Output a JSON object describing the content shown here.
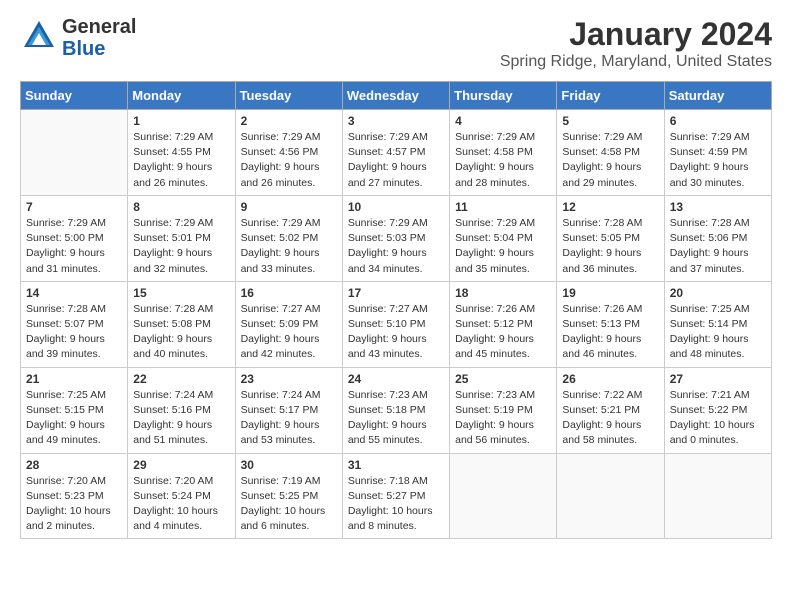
{
  "logo": {
    "name_general": "General",
    "name_blue": "Blue"
  },
  "header": {
    "month_year": "January 2024",
    "location": "Spring Ridge, Maryland, United States"
  },
  "weekdays": [
    "Sunday",
    "Monday",
    "Tuesday",
    "Wednesday",
    "Thursday",
    "Friday",
    "Saturday"
  ],
  "weeks": [
    [
      {
        "day": "",
        "info": ""
      },
      {
        "day": "1",
        "sunrise": "7:29 AM",
        "sunset": "4:55 PM",
        "daylight": "9 hours and 26 minutes."
      },
      {
        "day": "2",
        "sunrise": "7:29 AM",
        "sunset": "4:56 PM",
        "daylight": "9 hours and 26 minutes."
      },
      {
        "day": "3",
        "sunrise": "7:29 AM",
        "sunset": "4:57 PM",
        "daylight": "9 hours and 27 minutes."
      },
      {
        "day": "4",
        "sunrise": "7:29 AM",
        "sunset": "4:58 PM",
        "daylight": "9 hours and 28 minutes."
      },
      {
        "day": "5",
        "sunrise": "7:29 AM",
        "sunset": "4:58 PM",
        "daylight": "9 hours and 29 minutes."
      },
      {
        "day": "6",
        "sunrise": "7:29 AM",
        "sunset": "4:59 PM",
        "daylight": "9 hours and 30 minutes."
      }
    ],
    [
      {
        "day": "7",
        "sunrise": "7:29 AM",
        "sunset": "5:00 PM",
        "daylight": "9 hours and 31 minutes."
      },
      {
        "day": "8",
        "sunrise": "7:29 AM",
        "sunset": "5:01 PM",
        "daylight": "9 hours and 32 minutes."
      },
      {
        "day": "9",
        "sunrise": "7:29 AM",
        "sunset": "5:02 PM",
        "daylight": "9 hours and 33 minutes."
      },
      {
        "day": "10",
        "sunrise": "7:29 AM",
        "sunset": "5:03 PM",
        "daylight": "9 hours and 34 minutes."
      },
      {
        "day": "11",
        "sunrise": "7:29 AM",
        "sunset": "5:04 PM",
        "daylight": "9 hours and 35 minutes."
      },
      {
        "day": "12",
        "sunrise": "7:28 AM",
        "sunset": "5:05 PM",
        "daylight": "9 hours and 36 minutes."
      },
      {
        "day": "13",
        "sunrise": "7:28 AM",
        "sunset": "5:06 PM",
        "daylight": "9 hours and 37 minutes."
      }
    ],
    [
      {
        "day": "14",
        "sunrise": "7:28 AM",
        "sunset": "5:07 PM",
        "daylight": "9 hours and 39 minutes."
      },
      {
        "day": "15",
        "sunrise": "7:28 AM",
        "sunset": "5:08 PM",
        "daylight": "9 hours and 40 minutes."
      },
      {
        "day": "16",
        "sunrise": "7:27 AM",
        "sunset": "5:09 PM",
        "daylight": "9 hours and 42 minutes."
      },
      {
        "day": "17",
        "sunrise": "7:27 AM",
        "sunset": "5:10 PM",
        "daylight": "9 hours and 43 minutes."
      },
      {
        "day": "18",
        "sunrise": "7:26 AM",
        "sunset": "5:12 PM",
        "daylight": "9 hours and 45 minutes."
      },
      {
        "day": "19",
        "sunrise": "7:26 AM",
        "sunset": "5:13 PM",
        "daylight": "9 hours and 46 minutes."
      },
      {
        "day": "20",
        "sunrise": "7:25 AM",
        "sunset": "5:14 PM",
        "daylight": "9 hours and 48 minutes."
      }
    ],
    [
      {
        "day": "21",
        "sunrise": "7:25 AM",
        "sunset": "5:15 PM",
        "daylight": "9 hours and 49 minutes."
      },
      {
        "day": "22",
        "sunrise": "7:24 AM",
        "sunset": "5:16 PM",
        "daylight": "9 hours and 51 minutes."
      },
      {
        "day": "23",
        "sunrise": "7:24 AM",
        "sunset": "5:17 PM",
        "daylight": "9 hours and 53 minutes."
      },
      {
        "day": "24",
        "sunrise": "7:23 AM",
        "sunset": "5:18 PM",
        "daylight": "9 hours and 55 minutes."
      },
      {
        "day": "25",
        "sunrise": "7:23 AM",
        "sunset": "5:19 PM",
        "daylight": "9 hours and 56 minutes."
      },
      {
        "day": "26",
        "sunrise": "7:22 AM",
        "sunset": "5:21 PM",
        "daylight": "9 hours and 58 minutes."
      },
      {
        "day": "27",
        "sunrise": "7:21 AM",
        "sunset": "5:22 PM",
        "daylight": "10 hours and 0 minutes."
      }
    ],
    [
      {
        "day": "28",
        "sunrise": "7:20 AM",
        "sunset": "5:23 PM",
        "daylight": "10 hours and 2 minutes."
      },
      {
        "day": "29",
        "sunrise": "7:20 AM",
        "sunset": "5:24 PM",
        "daylight": "10 hours and 4 minutes."
      },
      {
        "day": "30",
        "sunrise": "7:19 AM",
        "sunset": "5:25 PM",
        "daylight": "10 hours and 6 minutes."
      },
      {
        "day": "31",
        "sunrise": "7:18 AM",
        "sunset": "5:27 PM",
        "daylight": "10 hours and 8 minutes."
      },
      {
        "day": "",
        "info": ""
      },
      {
        "day": "",
        "info": ""
      },
      {
        "day": "",
        "info": ""
      }
    ]
  ],
  "labels": {
    "sunrise": "Sunrise:",
    "sunset": "Sunset:",
    "daylight": "Daylight:"
  }
}
